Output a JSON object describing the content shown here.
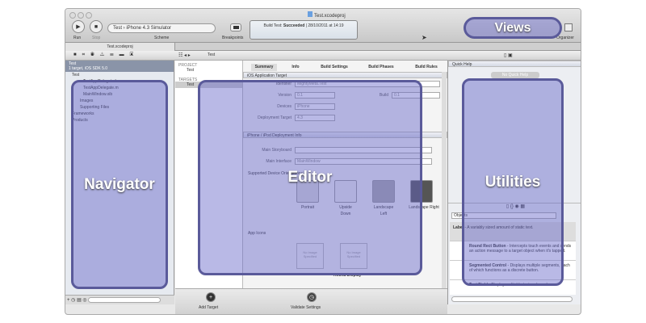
{
  "window": {
    "title": "Test.xcodeproj"
  },
  "toolbar": {
    "run": "Run",
    "stop": "Stop",
    "scheme_value": "Test › iPhone 4.3 Simulator",
    "scheme": "Scheme",
    "breakpoints": "Breakpoints",
    "status_prefix": "Build Test:",
    "status_result": "Succeeded",
    "status_time": "28/10/2011 at 14:19",
    "organizer": "Organizer"
  },
  "tab": "Test.xcodeproj",
  "navigator": {
    "project": "Test",
    "project_sub": "1 target, iOS SDK 5.0",
    "items": [
      "Test",
      "TestAppDelegate.h",
      "TestAppDelegate.m",
      "MainWindow.xib",
      "Images",
      "Supporting Files",
      "Frameworks",
      "Products"
    ]
  },
  "jumpbar": {
    "crumb": "Test"
  },
  "editor_side": {
    "project_header": "PROJECT",
    "project": "Test",
    "targets_header": "TARGETS",
    "target": "Test"
  },
  "tabs": [
    "Summary",
    "Info",
    "Build Settings",
    "Build Phases",
    "Build Rules"
  ],
  "summary": {
    "section": "iOS Application Target",
    "identifier_label": "Identifier",
    "identifier": "MightyMeta.Test",
    "version_label": "Version",
    "version": "0.1",
    "build_label": "Build",
    "build": "0.1",
    "devices_label": "Devices",
    "devices": "iPhone",
    "deploy_label": "Deployment Target",
    "deploy": "4.3",
    "section2": "iPhone / iPod Deployment Info",
    "storyboard_label": "Main Storyboard",
    "interface_label": "Main Interface",
    "interface": "MainWindow",
    "orient_header": "Supported Device Orientations",
    "orientations": [
      "Portrait",
      "Upside Down",
      "Landscape Left",
      "Landscape Right"
    ],
    "icons_header": "App Icons",
    "no_image": "No Image Specified",
    "retina": "Retina Display"
  },
  "bottom": {
    "add_target": "Add Target",
    "validate": "Validate Settings"
  },
  "utilities": {
    "quick_help": "Quick Help",
    "no_quick_help": "No Quick Help",
    "library_select": "Objects",
    "lib": [
      {
        "name": "Label",
        "desc": " - A variably sized amount of static text."
      },
      {
        "name": "Round Rect Button",
        "desc": " - Intercepts touch events and sends an action message to a target object when it's tapped."
      },
      {
        "name": "Segmented Control",
        "desc": " - Displays multiple segments, each of which functions as a discrete button."
      },
      {
        "name": "Text Field",
        "desc": " - Displays editable text and sends an"
      }
    ]
  },
  "overlays": {
    "views": "Views",
    "navigator": "Navigator",
    "editor": "Editor",
    "utilities": "Utilities"
  }
}
